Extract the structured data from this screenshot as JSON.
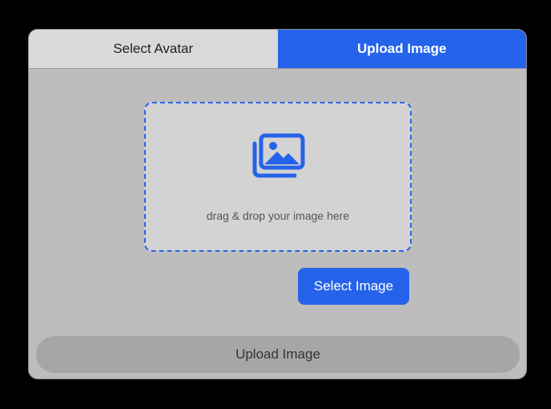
{
  "tabs": {
    "select_avatar": "Select Avatar",
    "upload_image": "Upload Image"
  },
  "dropzone": {
    "icon": "images-icon",
    "text": "drag & drop your image here"
  },
  "select_button": "Select Image",
  "upload_button": "Upload Image",
  "colors": {
    "accent": "#2563eb",
    "panel_bg": "#bdbdbd",
    "dropzone_bg": "#d3d3d3",
    "upload_button_bg": "#a6a6a6"
  }
}
